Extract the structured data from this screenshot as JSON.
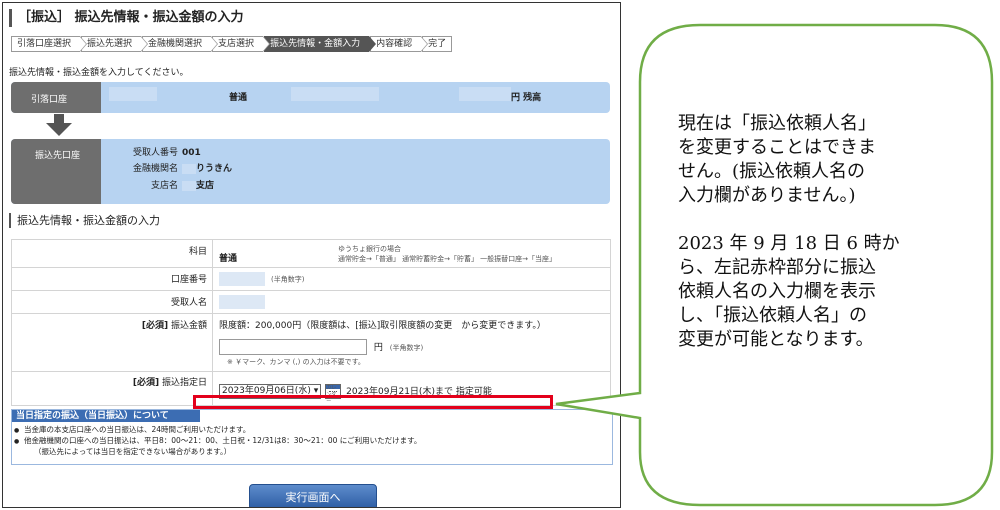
{
  "page": {
    "title": "［振込］ 振込先情報・振込金額の入力",
    "instruction": "振込先情報・振込金額を入力してください。"
  },
  "steps": [
    {
      "label": "引落口座選択",
      "active": false
    },
    {
      "label": "振込先選択",
      "active": false
    },
    {
      "label": "金融機関選択",
      "active": false
    },
    {
      "label": "支店選択",
      "active": false
    },
    {
      "label": "振込先情報・金額入力",
      "active": true
    },
    {
      "label": "内容確認",
      "active": false
    },
    {
      "label": "完了",
      "active": false
    }
  ],
  "from_account": {
    "label": "引落口座",
    "type": "普通",
    "balance_suffix": "円 残高"
  },
  "to_account": {
    "label": "振込先口座",
    "recipient_no_label": "受取人番号",
    "recipient_no": "001",
    "bank_label": "金融機関名",
    "bank": "りうきん",
    "branch_label": "支店名",
    "branch": "支店"
  },
  "section_title": "振込先情報・振込金額の入力",
  "form": {
    "subject_label": "科目",
    "subject_value": "普通",
    "subject_note1": "ゆうちょ銀行の場合",
    "subject_note2": "通常貯金→「普通」 通常貯蓄貯金→「貯蓄」 一般振替口座→「当座」",
    "acct_no_label": "口座番号",
    "acct_no_note": "(半角数字)",
    "recipient_name_label": "受取人名",
    "required_tag": "[必須]",
    "amount_label": "振込金額",
    "amount_limit": "限度額：200,000円（限度額は、[振込]取引限度額の変更　から変更できます。）",
    "amount_unit": "円",
    "amount_note": "(半角数字)",
    "amount_hint": "※ ￥マーク、カンマ (,) の入力は不要です。",
    "date_label": "振込指定日",
    "date_selected": "2023年09月06日(水)",
    "calendar_label": "カレンダー",
    "date_limit": "2023年09月21日(木)まで 指定可能"
  },
  "today_notice": {
    "heading": "当日指定の振込（当日振込）について",
    "items": [
      "当金庫の本支店口座への当日振込は、24時間ご利用いただけます。",
      "他金融機関の口座への当日振込は、平日8：00～21：00、土日祝・12/31は8：30～21：00 にご利用いただけます。"
    ],
    "sub_note": "（振込先によっては当日を指定できない場合があります。）"
  },
  "exec_button": "実行画面へ",
  "callout": {
    "para1": [
      "現在は「振込依頼人名」",
      "を変更することはできま",
      "せん。(振込依頼人名の",
      "入力欄がありません。)"
    ],
    "para2": [
      "2023 年 9 月 18 日 6 時か",
      "ら、左記赤枠部分に振込",
      "依頼人名の入力欄を表示",
      "し、「振込依頼人名」の",
      "変更が可能となります。"
    ]
  },
  "colors": {
    "highlight": "#e3001b",
    "callout_border": "#70ad47",
    "account_row": "#b7d3f1",
    "button": "#2c5ca3"
  }
}
